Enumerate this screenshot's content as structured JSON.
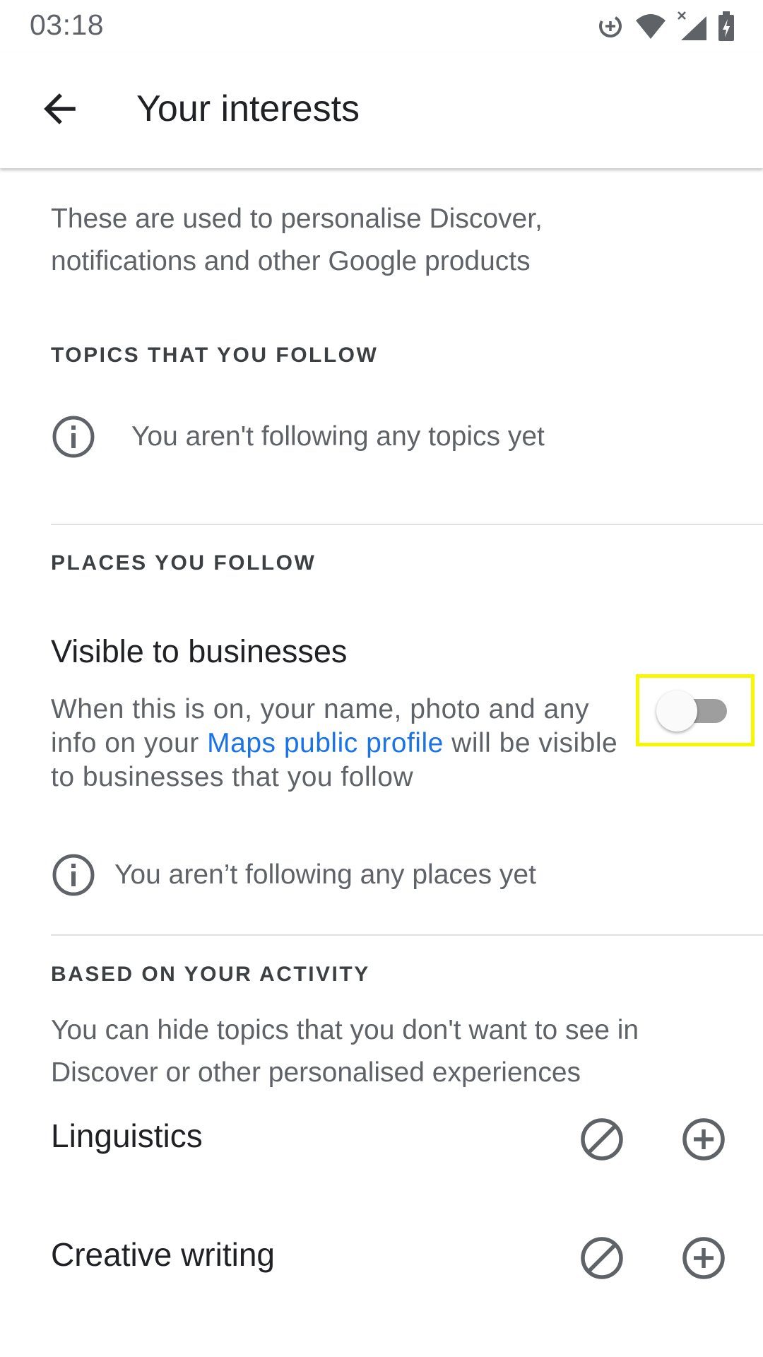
{
  "status_bar": {
    "time": "03:18",
    "icons": [
      "data-saver-icon",
      "wifi-icon",
      "cellular-no-service-icon",
      "battery-charging-icon"
    ]
  },
  "app_bar": {
    "back_icon": "arrow-back-icon",
    "title": "Your interests"
  },
  "intro": {
    "text": "These are used to personalise Discover, notifications and other Google products"
  },
  "topics_section": {
    "header": "TOPICS THAT YOU FOLLOW",
    "empty_icon": "info-icon",
    "empty_text": "You aren't following any topics yet"
  },
  "places_section": {
    "header": "PLACES YOU FOLLOW",
    "visibility": {
      "title": "Visible to businesses",
      "desc_before": "When this is on, your name, photo and any info on your ",
      "link_text": "Maps public profile",
      "desc_after": " will be visible to businesses that you follow",
      "toggle_on": false
    },
    "empty_icon": "info-icon",
    "empty_text": "You aren’t following any places yet"
  },
  "activity_section": {
    "header": "BASED ON YOUR ACTIVITY",
    "desc": "You can hide topics that you don't want to see in Discover or other personalised experiences",
    "topics": [
      {
        "label": "Linguistics",
        "hide_icon": "block-icon",
        "add_icon": "add-circle-icon"
      },
      {
        "label": "Creative writing",
        "hide_icon": "block-icon",
        "add_icon": "add-circle-icon"
      }
    ]
  },
  "colors": {
    "link": "#1a73e8",
    "highlight_frame": "#f7f700",
    "toggle_track_off": "#9e9e9e"
  }
}
